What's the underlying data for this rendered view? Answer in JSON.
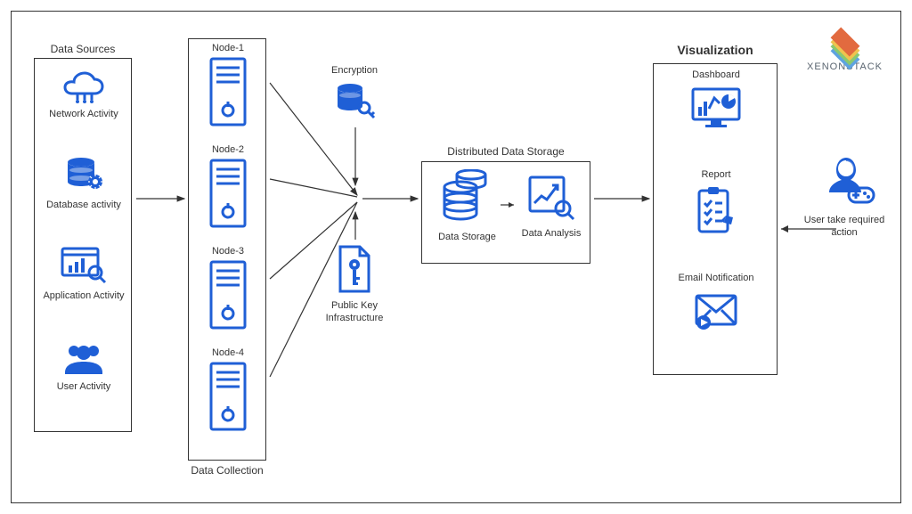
{
  "brand": {
    "name": "XENONSTACK"
  },
  "sections": {
    "dataSources": {
      "title": "Data Sources",
      "items": [
        {
          "label": "Network Activity"
        },
        {
          "label": "Database activity"
        },
        {
          "label": "Application Activity"
        },
        {
          "label": "User Activity"
        }
      ]
    },
    "dataCollection": {
      "title": "Data Collection",
      "nodes": [
        {
          "label": "Node-1"
        },
        {
          "label": "Node-2"
        },
        {
          "label": "Node-3"
        },
        {
          "label": "Node-4"
        }
      ]
    },
    "encryption": {
      "title": "Encryption"
    },
    "pki": {
      "title": "Public Key Infrastructure"
    },
    "storage": {
      "title": "Distributed Data Storage",
      "items": [
        {
          "label": "Data Storage"
        },
        {
          "label": "Data Analysis"
        }
      ]
    },
    "visualization": {
      "title": "Visualization",
      "items": [
        {
          "label": "Dashboard"
        },
        {
          "label": "Report"
        },
        {
          "label": "Email Notification"
        }
      ]
    },
    "user": {
      "title": "User take required action"
    }
  }
}
